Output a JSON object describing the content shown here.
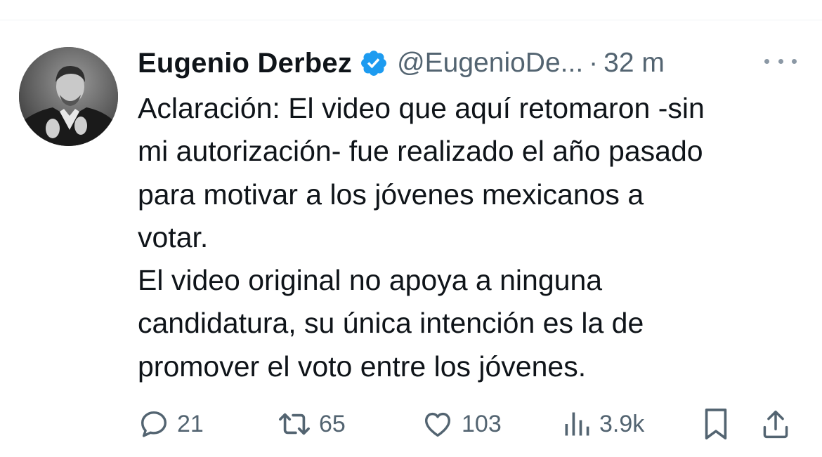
{
  "tweet": {
    "author": {
      "name": "Eugenio Derbez",
      "handle": "@EugenioDe...",
      "verified": true,
      "verified_color": "#1d9bf0"
    },
    "separator": "·",
    "time": "32 m",
    "text_lines": [
      "Aclaración: El video que aquí retomaron -sin",
      "mi autorización- fue realizado el año pasado",
      "para motivar a los jóvenes mexicanos a",
      "votar.",
      "El video original no apoya a ninguna",
      "candidatura, su única intención es la de",
      "promover el voto entre los jóvenes."
    ],
    "metrics": {
      "replies": "21",
      "retweets": "65",
      "likes": "103",
      "views": "3.9k"
    },
    "icons": {
      "reply": "reply-icon",
      "retweet": "retweet-icon",
      "like": "heart-icon",
      "views": "views-icon",
      "bookmark": "bookmark-icon",
      "share": "share-icon",
      "more": "more-icon"
    }
  }
}
